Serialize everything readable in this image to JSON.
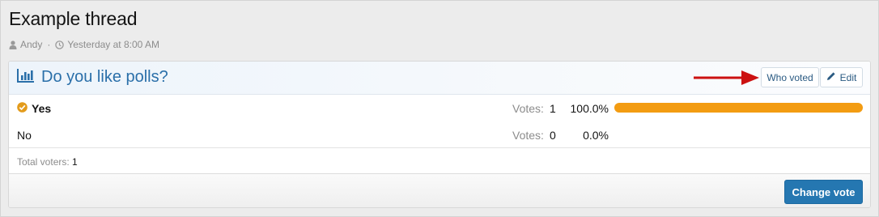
{
  "thread": {
    "title": "Example thread",
    "author": "Andy",
    "author_icon": "user-icon",
    "time_icon": "clock-icon",
    "timestamp": "Yesterday at 8:00 AM"
  },
  "poll": {
    "icon": "bar-chart-icon",
    "question": "Do you like polls?",
    "who_voted_label": "Who voted",
    "edit_label": "Edit",
    "edit_icon": "pencil-icon",
    "options": [
      {
        "label": "Yes",
        "selected": true,
        "votes_label": "Votes:",
        "votes": "1",
        "percent": "100.0%",
        "fraction": 1.0
      },
      {
        "label": "No",
        "selected": false,
        "votes_label": "Votes:",
        "votes": "0",
        "percent": "0.0%",
        "fraction": 0.0
      }
    ],
    "total_voters_label": "Total voters:",
    "total_voters": "1",
    "change_vote_label": "Change vote"
  },
  "colors": {
    "accent": "#2577b1",
    "title": "#2a6fa9",
    "bar": "#f39c12",
    "arrow": "#cc1111"
  }
}
